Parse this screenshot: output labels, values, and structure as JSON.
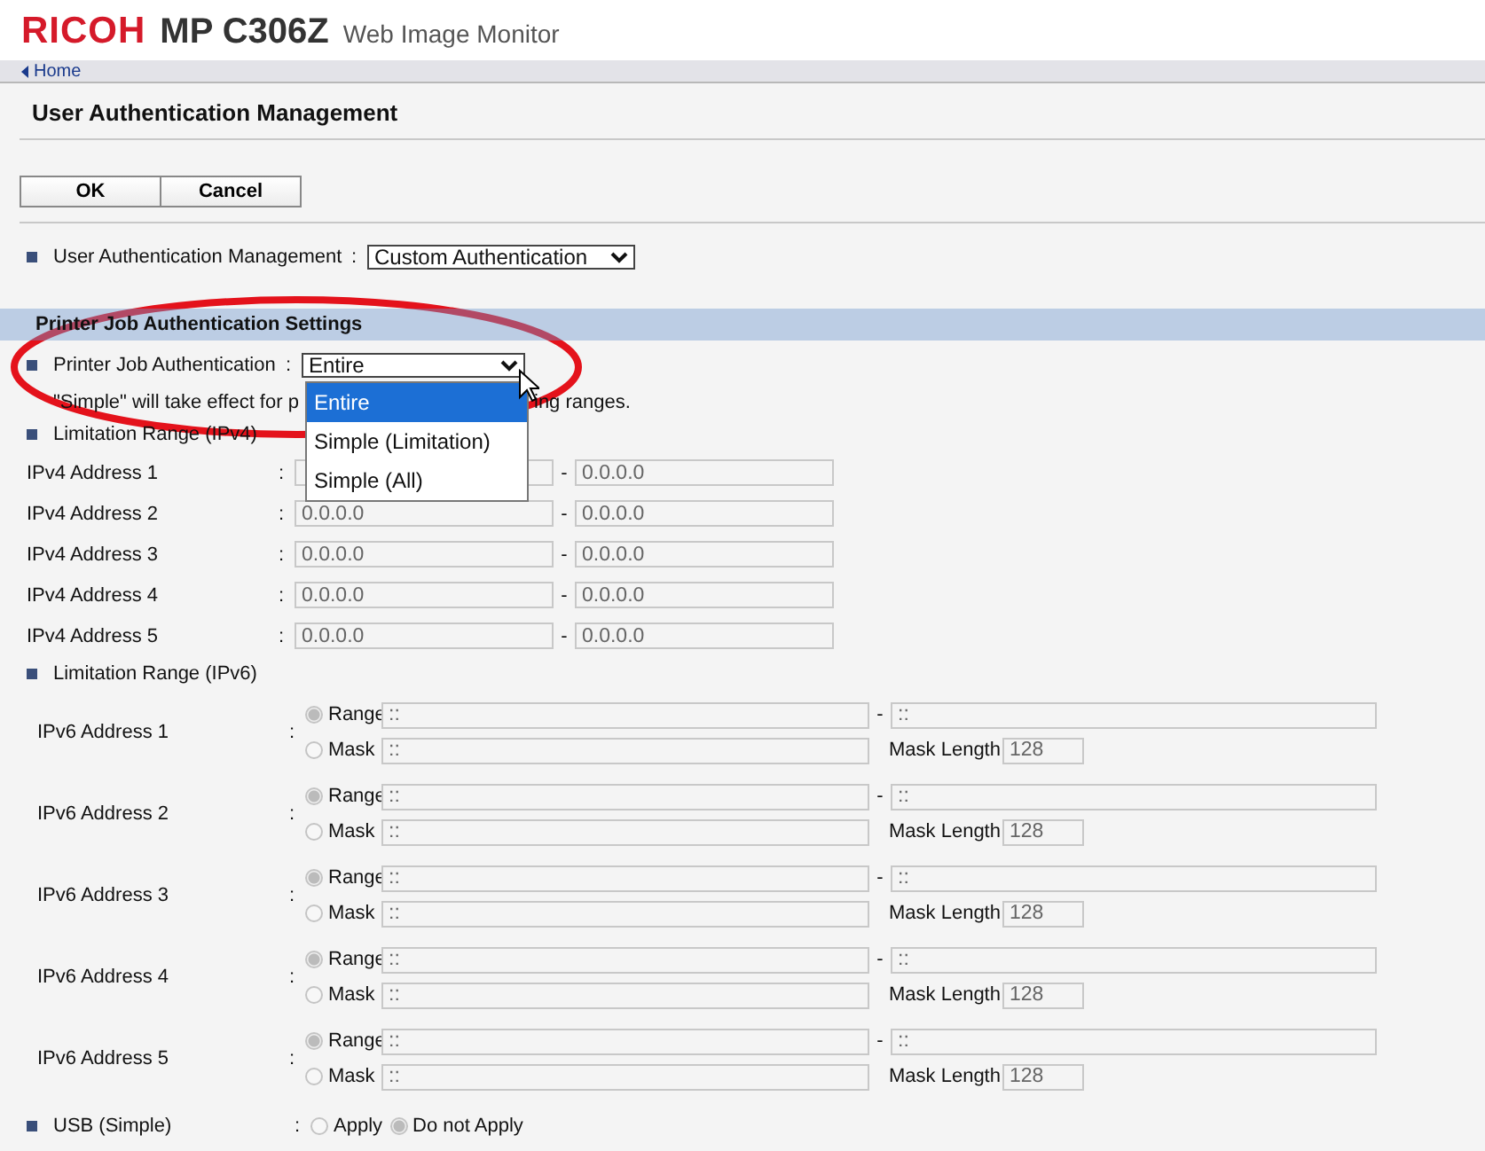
{
  "header": {
    "brand": "RICOH",
    "model": "MP C306Z",
    "product": "Web Image Monitor"
  },
  "breadcrumb": {
    "link": "Home"
  },
  "page_title": "User Authentication Management",
  "buttons": [
    "OK",
    "Cancel"
  ],
  "management": {
    "label": "User Authentication Management",
    "separator": ":",
    "value": "Custom Authentication"
  },
  "section": {
    "title": "Printer Job Authentication Settings"
  },
  "printer_job": {
    "label": "Printer Job Authentication",
    "separator": ":",
    "value": "Entire",
    "expanded": true,
    "options": [
      {
        "label": "Entire",
        "selected": true
      },
      {
        "label": "Simple (Limitation)",
        "selected": false
      },
      {
        "label": "Simple (All)",
        "selected": false
      }
    ]
  },
  "note": {
    "before": "\"Simple\" will take effect for p",
    "after": "ing ranges."
  },
  "ipv4": {
    "label": "Limitation Range (IPv4)",
    "rows": [
      {
        "label": "IPv4 Address 1",
        "separator": ":",
        "dash": "-",
        "to": "0.0.0.0"
      },
      {
        "label": "IPv4 Address 2",
        "separator": ":",
        "from": "0.0.0.0",
        "dash": "-",
        "to": "0.0.0.0"
      },
      {
        "label": "IPv4 Address 3",
        "separator": ":",
        "from": "0.0.0.0",
        "dash": "-",
        "to": "0.0.0.0"
      },
      {
        "label": "IPv4 Address 4",
        "separator": ":",
        "from": "0.0.0.0",
        "dash": "-",
        "to": "0.0.0.0"
      },
      {
        "label": "IPv4 Address 5",
        "separator": ":",
        "from": "0.0.0.0",
        "dash": "-",
        "to": "0.0.0.0"
      }
    ]
  },
  "ipv6": {
    "label": "Limitation Range (IPv6)",
    "rows": [
      {
        "label": "IPv6 Address 1",
        "separator": ":",
        "range": {
          "label": "Range",
          "selected": true,
          "from": "::",
          "dash": "-",
          "to": "::"
        },
        "mask": {
          "label": "Mask",
          "selected": false,
          "value": "::",
          "length_label": "Mask Length",
          "length": "128"
        }
      },
      {
        "label": "IPv6 Address 2",
        "separator": ":",
        "range": {
          "label": "Range",
          "selected": true,
          "from": "::",
          "dash": "-",
          "to": "::"
        },
        "mask": {
          "label": "Mask",
          "selected": false,
          "value": "::",
          "length_label": "Mask Length",
          "length": "128"
        }
      },
      {
        "label": "IPv6 Address 3",
        "separator": ":",
        "range": {
          "label": "Range",
          "selected": true,
          "from": "::",
          "dash": "-",
          "to": "::"
        },
        "mask": {
          "label": "Mask",
          "selected": false,
          "value": "::",
          "length_label": "Mask Length",
          "length": "128"
        }
      },
      {
        "label": "IPv6 Address 4",
        "separator": ":",
        "range": {
          "label": "Range",
          "selected": true,
          "from": "::",
          "dash": "-",
          "to": "::"
        },
        "mask": {
          "label": "Mask",
          "selected": false,
          "value": "::",
          "length_label": "Mask Length",
          "length": "128"
        }
      },
      {
        "label": "IPv6 Address 5",
        "separator": ":",
        "range": {
          "label": "Range",
          "selected": true,
          "from": "::",
          "dash": "-",
          "to": "::"
        },
        "mask": {
          "label": "Mask",
          "selected": false,
          "value": "::",
          "length_label": "Mask Length",
          "length": "128"
        }
      }
    ]
  },
  "usb": {
    "label": "USB (Simple)",
    "separator": ":",
    "options": [
      {
        "label": "Apply",
        "selected": false
      },
      {
        "label": "Do not Apply",
        "selected": true
      }
    ]
  }
}
